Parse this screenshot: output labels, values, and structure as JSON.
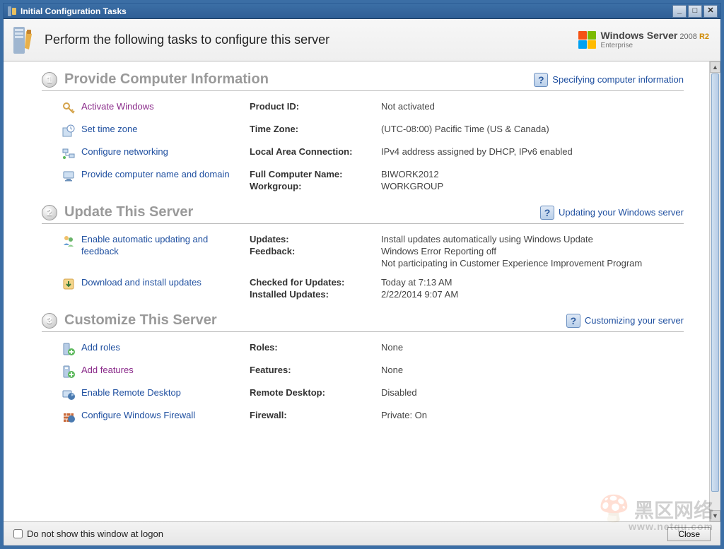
{
  "window": {
    "title": "Initial Configuration Tasks"
  },
  "header": {
    "heading": "Perform the following tasks to configure this server",
    "brand_name": "Windows Server",
    "brand_year": "2008",
    "brand_r2": "R2",
    "brand_edition": "Enterprise"
  },
  "sections": {
    "s1": {
      "num": "1",
      "title": "Provide Computer Information",
      "help_label": "Specifying computer information"
    },
    "s2": {
      "num": "2",
      "title": "Update This Server",
      "help_label": "Updating your Windows server"
    },
    "s3": {
      "num": "3",
      "title": "Customize This Server",
      "help_label": "Customizing your server"
    }
  },
  "tasks": {
    "activate": {
      "label": "Activate Windows",
      "k1": "Product ID:",
      "v1": "Not activated"
    },
    "timezone": {
      "label": "Set time zone",
      "k1": "Time Zone:",
      "v1": "(UTC-08:00) Pacific Time (US & Canada)"
    },
    "network": {
      "label": "Configure networking",
      "k1": "Local Area Connection:",
      "v1": "IPv4 address assigned by DHCP, IPv6 enabled"
    },
    "name": {
      "label": "Provide computer name and domain",
      "k1": "Full Computer Name:",
      "v1": "BIWORK2012",
      "k2": "Workgroup:",
      "v2": "WORKGROUP"
    },
    "autoupdate": {
      "label": "Enable automatic updating and feedback",
      "k1": "Updates:",
      "v1": "Install updates automatically using Windows Update",
      "k2": "Feedback:",
      "v2a": "Windows Error Reporting off",
      "v2b": "Not participating in Customer Experience Improvement Program"
    },
    "download": {
      "label": "Download and install updates",
      "k1": "Checked for Updates:",
      "v1": "Today at 7:13 AM",
      "k2": "Installed Updates:",
      "v2": "2/22/2014 9:07 AM"
    },
    "roles": {
      "label": "Add roles",
      "k1": "Roles:",
      "v1": "None"
    },
    "features": {
      "label": "Add features",
      "k1": "Features:",
      "v1": "None"
    },
    "remote": {
      "label": "Enable Remote Desktop",
      "k1": "Remote Desktop:",
      "v1": "Disabled"
    },
    "firewall": {
      "label": "Configure Windows Firewall",
      "k1": "Firewall:",
      "v1": "Private: On"
    }
  },
  "footer": {
    "checkbox_label": "Do not show this window at logon",
    "close_label": "Close"
  },
  "watermark": {
    "text": "黑区网络",
    "url": "www.netqu.com"
  }
}
